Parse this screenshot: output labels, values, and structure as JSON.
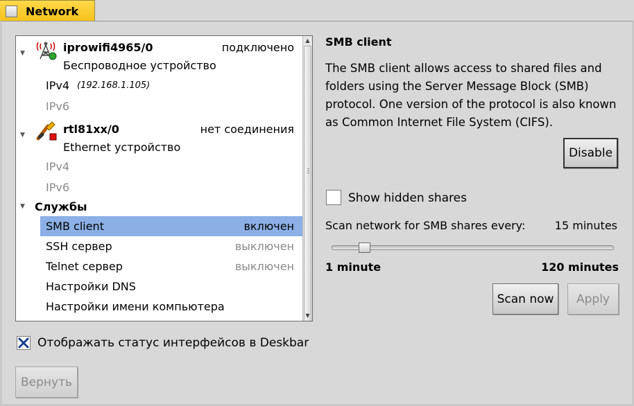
{
  "window": {
    "title": "Network"
  },
  "interfaces": [
    {
      "name": "iprowifi4965/0",
      "status": "подключено",
      "type": "Беспроводное устройство",
      "icon": "wifi-antenna-icon",
      "ipv4_label": "IPv4",
      "ipv4_addr": "(192.168.1.105)",
      "ipv6_label": "IPv6"
    },
    {
      "name": "rtl81xx/0",
      "status": "нет соединения",
      "type": "Ethernet устройство",
      "icon": "ethernet-plug-icon",
      "ipv4_label": "IPv4",
      "ipv6_label": "IPv6"
    }
  ],
  "services": {
    "header": "Службы",
    "items": [
      {
        "label": "SMB client",
        "status": "включен"
      },
      {
        "label": "SSH сервер",
        "status": "выключен"
      },
      {
        "label": "Telnet сервер",
        "status": "выключен"
      },
      {
        "label": "Настройки DNS",
        "status": ""
      },
      {
        "label": "Настройки имени компьютера",
        "status": ""
      }
    ]
  },
  "deskbar_checkbox": {
    "label": "Отображать статус интерфейсов в Deskbar",
    "checked": true
  },
  "revert_button": "Вернуть",
  "detail": {
    "title": "SMB client",
    "description_lines": [
      "The SMB client allows access to shared files and",
      "folders using the Server Message Block (SMB)",
      "protocol. One version of the protocol is also known",
      "as Common Internet File System (CIFS)."
    ],
    "disable_button": "Disable",
    "show_hidden_label": "Show hidden shares",
    "show_hidden_checked": false,
    "scan_label": "Scan network for SMB shares every:",
    "scan_value": "15 minutes",
    "slider_min_label": "1 minute",
    "slider_max_label": "120 minutes",
    "scan_now_button": "Scan now",
    "apply_button": "Apply"
  },
  "colors": {
    "tab": "#f5c21a",
    "selection": "#8cb0e6",
    "background": "#d8d8d8"
  }
}
